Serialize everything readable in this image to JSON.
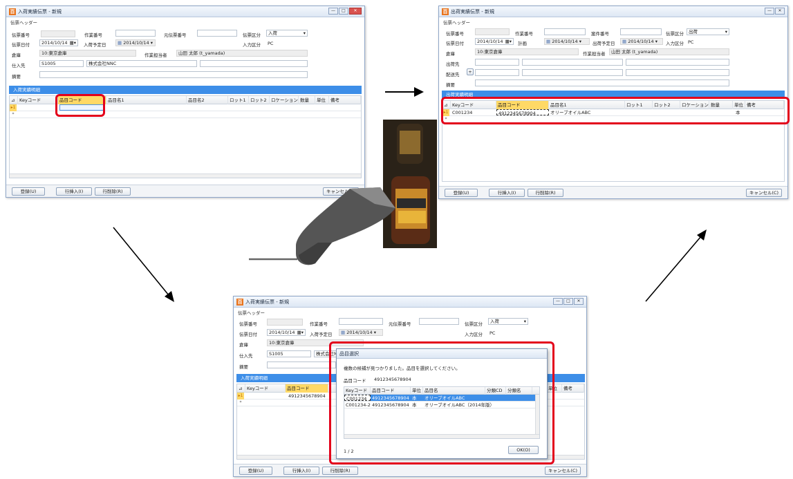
{
  "window_title_new": "入荷実績伝票 - 新規",
  "window_title_ship": "出荷実績伝票 - 新規",
  "dialog_title": "品目選択",
  "header_section": "伝票ヘッダー",
  "labels": {
    "slip_no": "伝票番号",
    "work_no": "作業番号",
    "ref_slip_no": "元伝票番号",
    "slip_type": "伝票区分",
    "slip_date": "伝票日付",
    "arrival_planned": "入荷予定日",
    "input_type": "入力区分",
    "warehouse": "倉庫",
    "staff": "作業担当者",
    "supplier": "仕入先",
    "memo": "摘要",
    "case_no": "案件番号",
    "ship_base": "計画",
    "ship_planned": "出荷予定日",
    "ship_dest": "出荷先",
    "delivery_dest": "配送先"
  },
  "values": {
    "slip_type_in": "入荷",
    "slip_type_out": "出荷",
    "slip_date": "2014/10/14",
    "planned_date": "2014/10/14",
    "input_type": "PC",
    "warehouse": "10:東京倉庫",
    "staff": "山田 太郎 (t_yamada)",
    "supplier_code": "S1005",
    "supplier_name": "株式会社NNC",
    "supplier_name_short": "株式会社NN"
  },
  "detail_in": "入荷実績明細",
  "detail_out": "出荷実績明細",
  "columns_in": [
    "Keyコード",
    "品目コード",
    "品目名1",
    "品目名2",
    "ロット1",
    "ロット2",
    "ロケーション",
    "数量",
    "単位",
    "備考"
  ],
  "columns_out": [
    "Keyコード",
    "品目コード",
    "品目名1",
    "ロット1",
    "ロット2",
    "ロケーション",
    "数量",
    "単位",
    "備考"
  ],
  "row_marker": "1",
  "new_row_marker": "*",
  "ship_row": {
    "key": "C001234",
    "code": "4912345678904",
    "name": "オリーブオイルABC",
    "unit": "本"
  },
  "scanned_code": "4912345678904",
  "buttons": {
    "register": "登録(U)",
    "insert_row": "行挿入(I)",
    "delete_row": "行削除(R)",
    "cancel": "キャンセル(C)",
    "ok": "OK(O)"
  },
  "dialog": {
    "message": "複数の候補が見つかりました。品目を選択してください。",
    "code_label": "品目コード",
    "code_value": "4912345678904",
    "columns": [
      "Keyコード",
      "品目コード",
      "単位",
      "品目名",
      "分類CD",
      "分類名"
    ],
    "rows": [
      {
        "key": "C001234",
        "code": "4912345678904",
        "unit": "本",
        "name": "オリーブオイルABC"
      },
      {
        "key": "C001234-2",
        "code": "4912345678904",
        "unit": "本",
        "name": "オリーブオイルABC（2014年版）"
      }
    ],
    "page": "1 / 2"
  },
  "colors": {
    "highlight": "#e3001b",
    "header_bar": "#3d8ee8",
    "selected_row": "#3d8ee8",
    "code_column": "#ffd966"
  }
}
